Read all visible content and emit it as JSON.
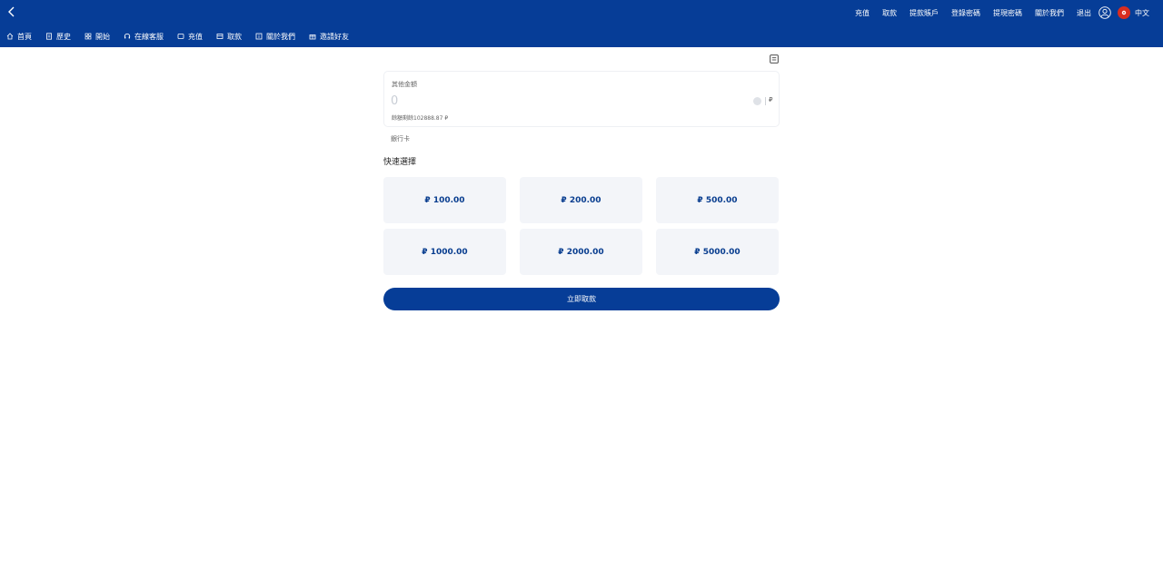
{
  "topnav": [
    "充值",
    "取款",
    "提款賬戶",
    "登錄密碼",
    "提現密碼",
    "關於我們",
    "退出"
  ],
  "language": "中文",
  "subnav": [
    {
      "label": "首頁",
      "icon": "home-icon"
    },
    {
      "label": "歷史",
      "icon": "history-icon"
    },
    {
      "label": "開始",
      "icon": "grid-icon"
    },
    {
      "label": "在線客服",
      "icon": "headset-icon"
    },
    {
      "label": "充值",
      "icon": "deposit-icon"
    },
    {
      "label": "取款",
      "icon": "withdraw-icon"
    },
    {
      "label": "關於我們",
      "icon": "info-icon"
    },
    {
      "label": "邀請好友",
      "icon": "gift-icon"
    }
  ],
  "form": {
    "amount_label": "其他金額",
    "amount_placeholder": "0",
    "currency": "₽",
    "balance": "餘額剩餘102888.87 ₽",
    "bank_label": "銀行卡",
    "quick_title": "快速選擇",
    "quick_options": [
      "₽ 100.00",
      "₽ 200.00",
      "₽ 500.00",
      "₽ 1000.00",
      "₽ 2000.00",
      "₽ 5000.00"
    ],
    "submit": "立即取款"
  },
  "colors": {
    "primary": "#063d97",
    "flag": "#d92d20",
    "option_bg": "#f3f5f9"
  }
}
